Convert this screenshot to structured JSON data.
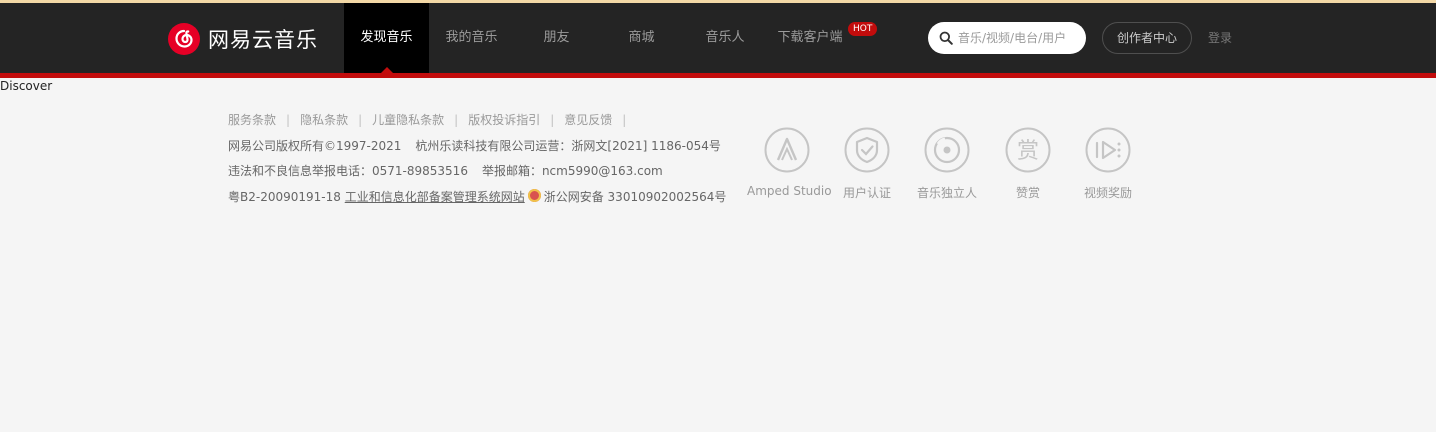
{
  "header": {
    "logo_text": "网易云音乐",
    "nav": [
      {
        "label": "发现音乐",
        "active": true
      },
      {
        "label": "我的音乐"
      },
      {
        "label": "朋友"
      },
      {
        "label": "商城"
      },
      {
        "label": "音乐人"
      },
      {
        "label": "下载客户端",
        "badge": "HOT"
      }
    ],
    "search_placeholder": "音乐/视频/电台/用户",
    "creator_center": "创作者中心",
    "login": "登录"
  },
  "main": {
    "label": "Discover"
  },
  "footer": {
    "links": [
      "服务条款",
      "隐私条款",
      "儿童隐私条款",
      "版权投诉指引",
      "意见反馈"
    ],
    "separator": "|",
    "copyright": "网易公司版权所有©1997-2021",
    "operator": "杭州乐读科技有限公司运营：浙网文[2021] 1186-054号",
    "report_phone": "违法和不良信息举报电话：0571-89853516",
    "report_email": "举报邮箱：ncm5990@163.com",
    "icp": "粤B2-20090191-18",
    "icp_link": "工业和信息化部备案管理系统网站",
    "police": "浙公网安备 33010902002564号",
    "badges": [
      {
        "label": "Amped Studio",
        "icon": "amped-studio-icon"
      },
      {
        "label": "用户认证",
        "icon": "user-verify-icon"
      },
      {
        "label": "音乐独立人",
        "icon": "independent-musician-icon"
      },
      {
        "label": "赞赏",
        "icon": "reward-icon"
      },
      {
        "label": "视频奖励",
        "icon": "video-reward-icon"
      }
    ]
  },
  "colors": {
    "header_bg": "#242424",
    "accent_red": "#c20c0c",
    "page_bg": "#f5f5f5"
  }
}
